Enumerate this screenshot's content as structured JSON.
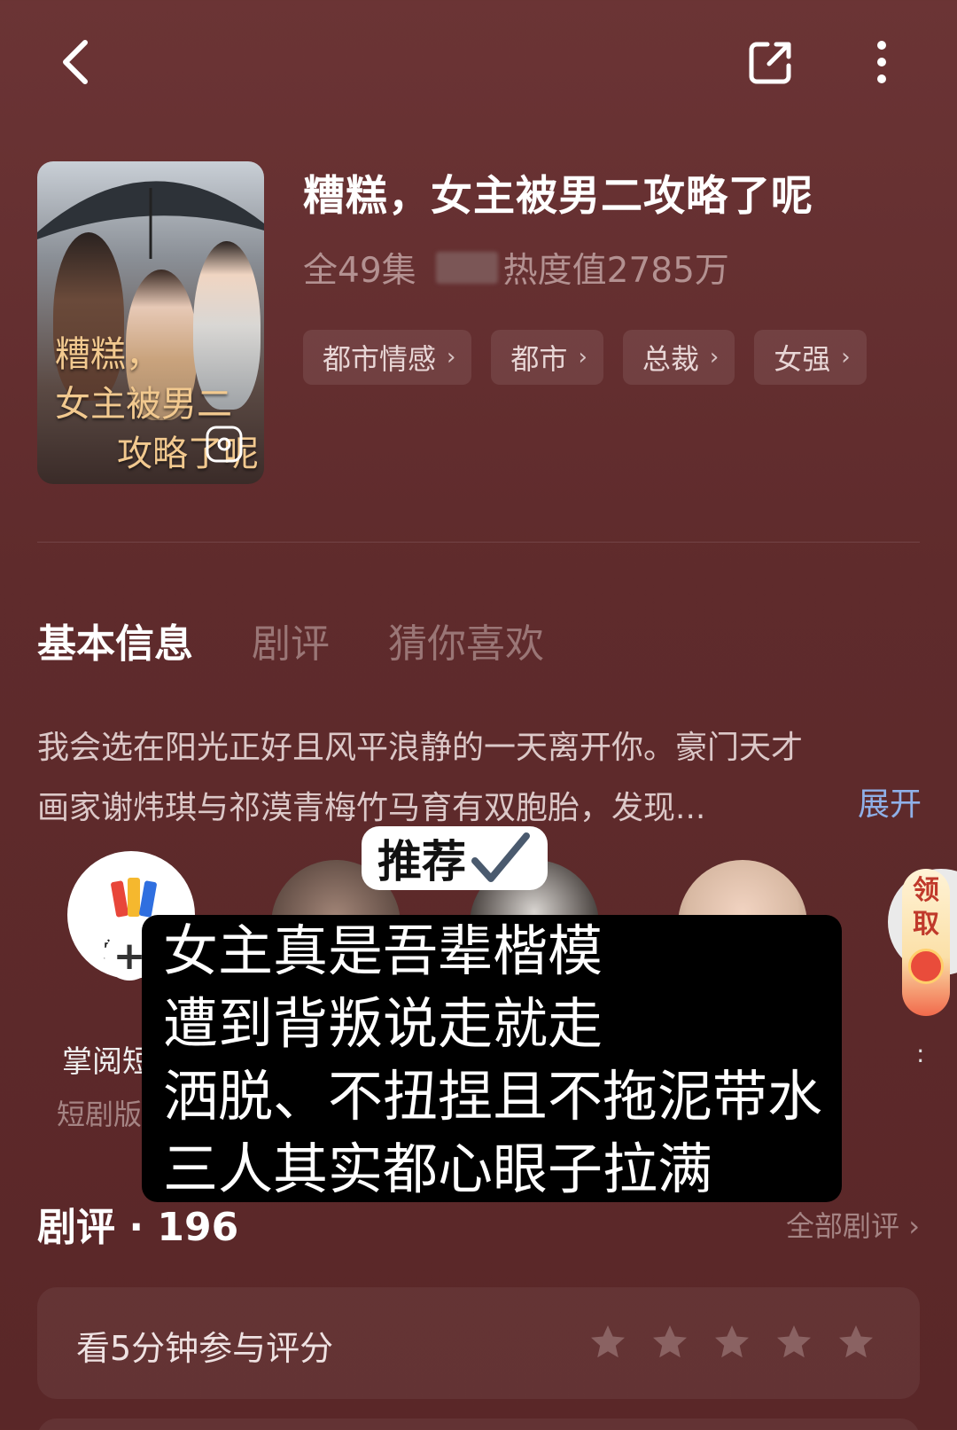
{
  "title": "糟糕，女主被男二攻略了呢",
  "meta": {
    "episodes": "全49集",
    "heat": "热度值2785万"
  },
  "tags": [
    "都市情感",
    "都市",
    "总裁",
    "女强"
  ],
  "cover": {
    "title_line1": "糟糕，",
    "title_line2": "女主被男二",
    "title_line3": "攻略了呢"
  },
  "tabs": [
    "基本信息",
    "剧评",
    "猜你喜欢"
  ],
  "synopsis": {
    "line1": "我会选在阳光正好且风平浪静的一天离开你。豪门天才",
    "line2": "画家谢炜琪与祁漠青梅竹马育有双胞胎，发现...",
    "expand": "展开"
  },
  "creator": {
    "logo_text": "掌阅",
    "name": "掌阅短",
    "sub": "短剧版",
    "follow": "+"
  },
  "claim": {
    "line1": "领",
    "line2": "取"
  },
  "recommend_label": "推荐",
  "overlay": {
    "line1": "女主真是吾辈楷模",
    "line2": "遭到背叛说走就走",
    "line3": "洒脱、不扭捏且不拖泥带水",
    "line4": "三人其实都心眼子拉满"
  },
  "reviews": {
    "heading": "剧评 · 196",
    "all": "全部剧评 ›",
    "rate_prompt": "看5分钟参与评分",
    "star_count": 5
  },
  "colors": {
    "background": "#5f2b2c",
    "accent_link": "#8fb0e8"
  }
}
